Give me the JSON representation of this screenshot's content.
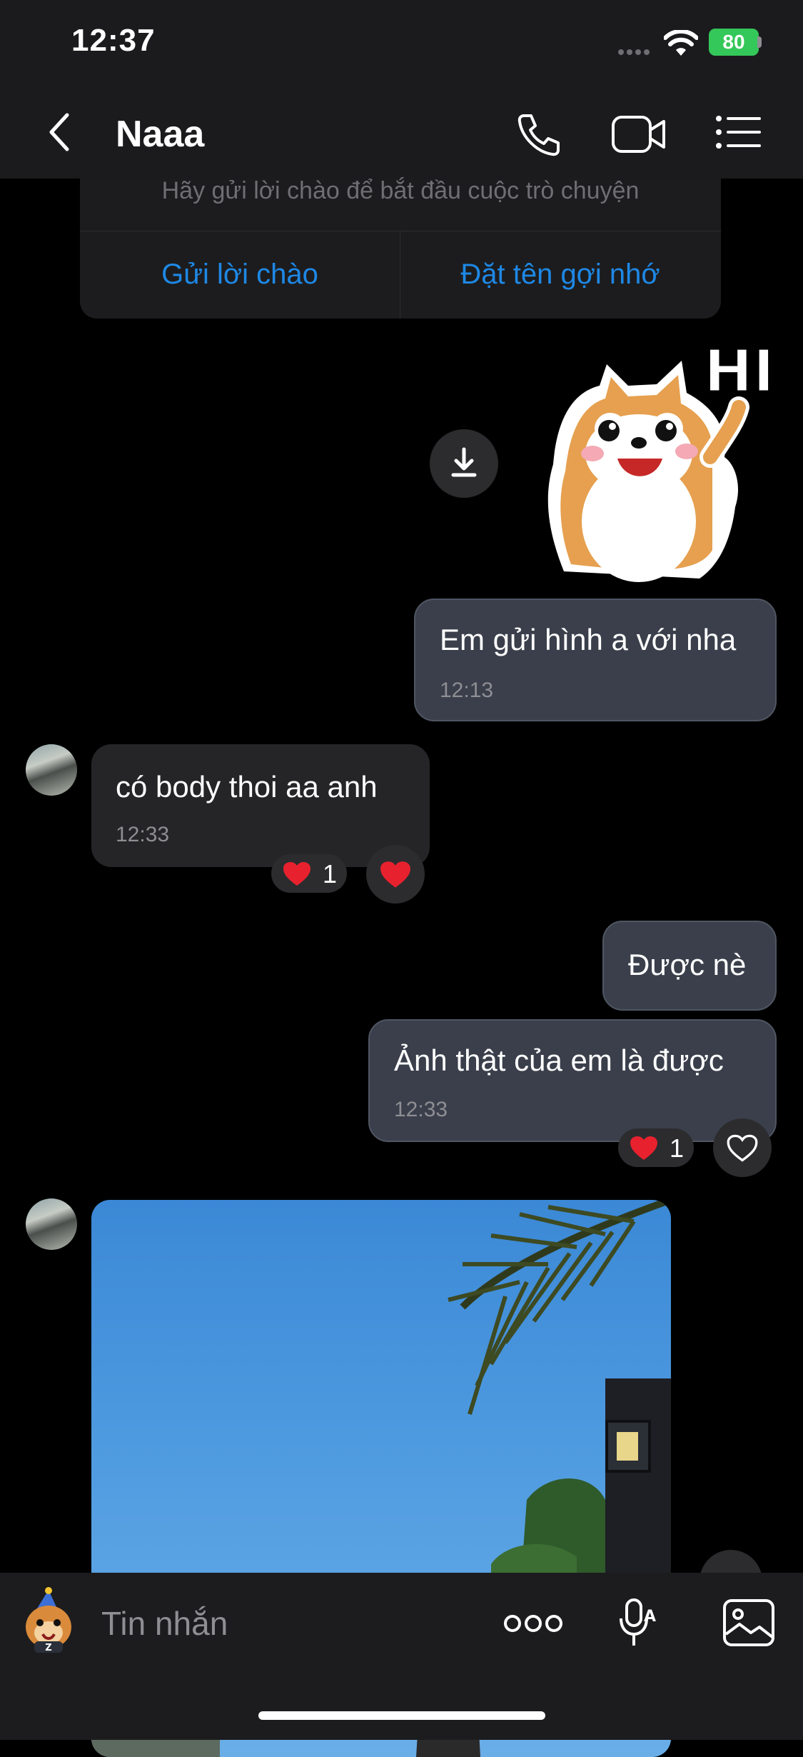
{
  "status_bar": {
    "time": "12:37",
    "battery": "80"
  },
  "header": {
    "contact_name": "Naaa"
  },
  "intro": {
    "text": "Hãy gửi lời chào để bắt đầu cuộc trò chuyện",
    "greet_button": "Gửi lời chào",
    "nickname_button": "Đặt tên gợi nhớ"
  },
  "sticker": {
    "caption": "HI"
  },
  "messages": [
    {
      "direction": "out",
      "text": "Em gửi hình a với nha",
      "time": "12:13"
    },
    {
      "direction": "in",
      "text": "có body thoi aa anh",
      "time": "12:33",
      "reaction_count": "1"
    },
    {
      "direction": "out",
      "text": "Được nè"
    },
    {
      "direction": "out",
      "text": "Ảnh thật của em là được",
      "time": "12:33",
      "reaction_count": "1"
    }
  ],
  "composer": {
    "placeholder": "Tin nhắn"
  },
  "colors": {
    "accent": "#1e88e5",
    "outgoing_bubble": "#3a3f4b",
    "incoming_bubble": "#252527",
    "reaction": "#e8212e"
  },
  "icons": [
    "back-icon",
    "phone-icon",
    "video-call-icon",
    "menu-list-icon",
    "download-icon",
    "heart-icon",
    "more-icon",
    "voice-icon",
    "gallery-icon",
    "sticker-icon"
  ]
}
